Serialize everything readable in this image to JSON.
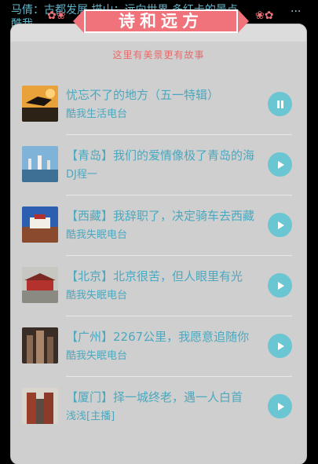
{
  "header": {
    "title": "诗和远方",
    "subtitle": "这里有美景更有故事"
  },
  "background_ticker": {
    "line1": "马倩：古都发展      描山：远向世界      多红卡的景点",
    "line2": "酷我",
    "more": "..."
  },
  "episodes": [
    {
      "title": "忧忘不了的地方（五一特辑）",
      "author": "酷我生活电台",
      "state": "pause-icon"
    },
    {
      "title": "【青岛】我们的爱情像极了青岛的海",
      "author": "DJ程一",
      "state": "play-icon"
    },
    {
      "title": "【西藏】我辞职了，决定骑车去西藏",
      "author": "酷我失眠电台",
      "state": "play-icon"
    },
    {
      "title": "【北京】北京很苦，但人眼里有光",
      "author": "酷我失眠电台",
      "state": "play-icon"
    },
    {
      "title": "【广州】2267公里，我愿意追随你",
      "author": "酷我失眠电台",
      "state": "play-icon"
    },
    {
      "title": "【厦门】择一城终老，遇一人白首",
      "author": "浅浅[主播]",
      "state": "play-icon"
    }
  ],
  "colors": {
    "accent": "#4aa8bf",
    "play_button": "#6bc6d3",
    "banner": "#f0727a"
  }
}
